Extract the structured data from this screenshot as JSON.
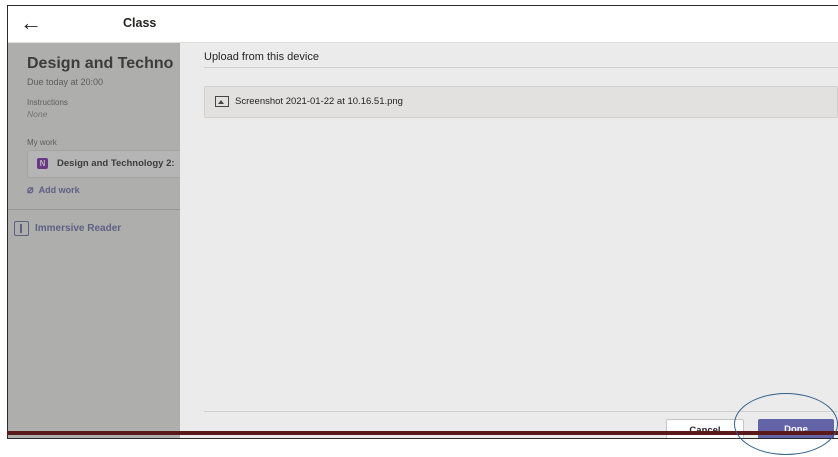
{
  "header": {
    "back_label": "←",
    "title": "Class"
  },
  "sidebar": {
    "assignment_title": "Design and Techno",
    "due": "Due today at 20:00",
    "instructions_label": "Instructions",
    "instructions_value": "None",
    "my_work_label": "My work",
    "work_item_label": "Design and Technology 2:",
    "add_work_label": "Add work",
    "immersive_reader_label": "Immersive Reader"
  },
  "dialog": {
    "heading": "Upload from this device",
    "files": [
      {
        "name": "Screenshot 2021-01-22 at 10.16.51.png",
        "icon": "image-file-icon"
      }
    ],
    "cancel_label": "Cancel",
    "done_label": "Done"
  },
  "colors": {
    "accent": "#6264a7",
    "highlight_ring": "#2e5f8c"
  }
}
